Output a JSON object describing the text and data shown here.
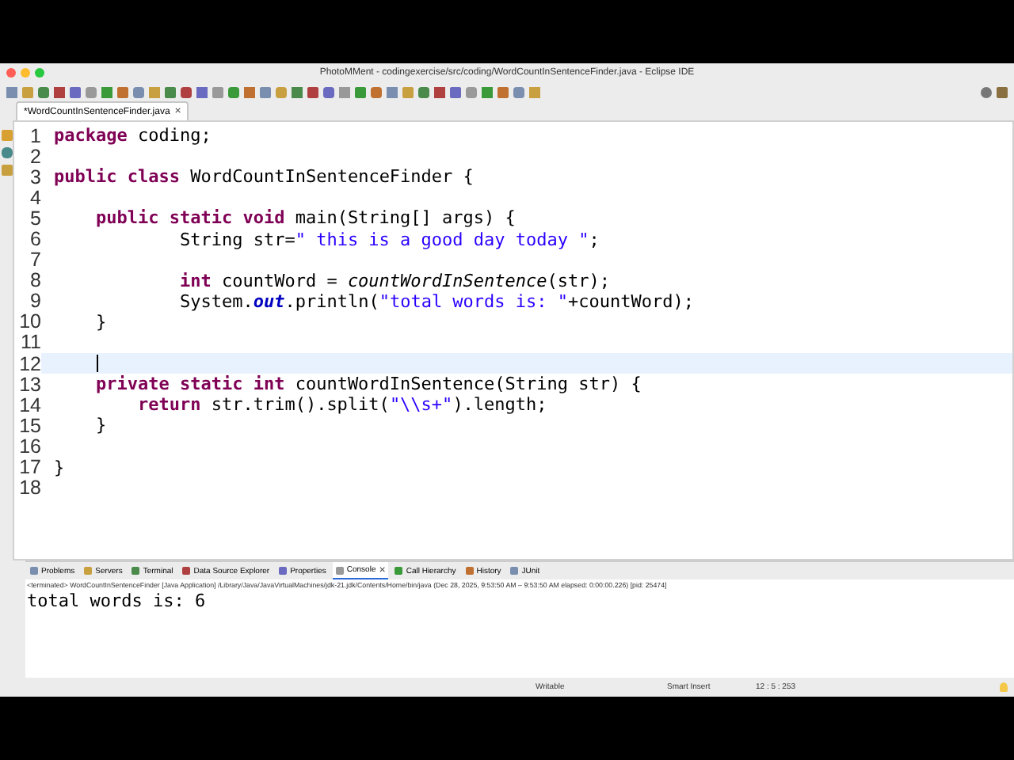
{
  "window": {
    "title": "PhotoMMent - codingexercise/src/coding/WordCountInSentenceFinder.java - Eclipse IDE"
  },
  "editor_tabs": [
    {
      "label": "*WordCountInSentenceFinder.java",
      "close": "×",
      "selected": true
    }
  ],
  "code_lines": [
    {
      "number": "1",
      "current": false,
      "tokens": [
        {
          "kind": "keyword",
          "text": "package"
        },
        {
          "kind": "plain",
          "text": " coding;"
        }
      ]
    },
    {
      "number": "2",
      "current": false
    },
    {
      "number": "3",
      "current": false,
      "tokens": [
        {
          "kind": "keyword",
          "text": "public class"
        },
        {
          "kind": "plain",
          "text": " WordCountInSentenceFinder {"
        }
      ]
    },
    {
      "number": "4",
      "current": false
    },
    {
      "number": "5",
      "current": false,
      "tokens": [
        {
          "kind": "keyword",
          "text": "    public static void"
        },
        {
          "kind": "plain",
          "text": " main(String[] args) {"
        }
      ]
    },
    {
      "number": "6",
      "current": false,
      "tokens": [
        {
          "kind": "plain",
          "text": "            String str="
        },
        {
          "kind": "string",
          "text": "\" this is a good day today \""
        },
        {
          "kind": "plain",
          "text": ";"
        }
      ]
    },
    {
      "number": "7",
      "current": false
    },
    {
      "number": "8",
      "current": false,
      "tokens": [
        {
          "kind": "keyword",
          "text": "            int"
        },
        {
          "kind": "plain",
          "text": " countWord = "
        },
        {
          "kind": "call",
          "text": "countWordInSentence"
        },
        {
          "kind": "plain",
          "text": "(str);"
        }
      ]
    },
    {
      "number": "9",
      "current": false,
      "tokens": [
        {
          "kind": "plain",
          "text": "            System."
        },
        {
          "kind": "field",
          "text": "out"
        },
        {
          "kind": "plain",
          "text": ".println("
        },
        {
          "kind": "string",
          "text": "\"total words is: \""
        },
        {
          "kind": "plain",
          "text": "+countWord);"
        }
      ]
    },
    {
      "number": "10",
      "current": false,
      "tokens": [
        {
          "kind": "plain",
          "text": "    }"
        }
      ]
    },
    {
      "number": "11",
      "current": false
    },
    {
      "number": "12",
      "current": true
    },
    {
      "number": "13",
      "current": false,
      "tokens": [
        {
          "kind": "keyword",
          "text": "    private static int"
        },
        {
          "kind": "plain",
          "text": " countWordInSentence(String str) {"
        }
      ]
    },
    {
      "number": "14",
      "current": false,
      "tokens": [
        {
          "kind": "keyword",
          "text": "        return"
        },
        {
          "kind": "plain",
          "text": " str.trim().split("
        },
        {
          "kind": "string",
          "text": "\"\\\\s+\""
        },
        {
          "kind": "plain",
          "text": ").length;"
        }
      ]
    },
    {
      "number": "15",
      "current": false,
      "tokens": [
        {
          "kind": "plain",
          "text": "    }"
        }
      ]
    },
    {
      "number": "16",
      "current": false
    },
    {
      "number": "17",
      "current": false,
      "tokens": [
        {
          "kind": "plain",
          "text": "}"
        }
      ]
    },
    {
      "number": "18",
      "current": false
    }
  ],
  "panel_tabs": [
    {
      "label": "Problems",
      "selected": false
    },
    {
      "label": "Servers",
      "selected": false
    },
    {
      "label": "Terminal",
      "selected": false
    },
    {
      "label": "Data Source Explorer",
      "selected": false
    },
    {
      "label": "Properties",
      "selected": false
    },
    {
      "label": "Console",
      "selected": true,
      "close": "×"
    },
    {
      "label": "Call Hierarchy",
      "selected": false
    },
    {
      "label": "History",
      "selected": false
    },
    {
      "label": "JUnit",
      "selected": false
    }
  ],
  "console": {
    "header": "<terminated> WordCountInSentenceFinder [Java Application] /Library/Java/JavaVirtualMachines/jdk-21.jdk/Contents/Home/bin/java  (Dec 28, 2025, 9:53:50 AM – 9:53:50 AM elapsed: 0:00:00.226) [pid: 25474]",
    "output": "total words is: 6"
  },
  "status_bar": {
    "mode": "Writable",
    "insert": "Smart Insert",
    "position": "12 : 5 : 253"
  }
}
